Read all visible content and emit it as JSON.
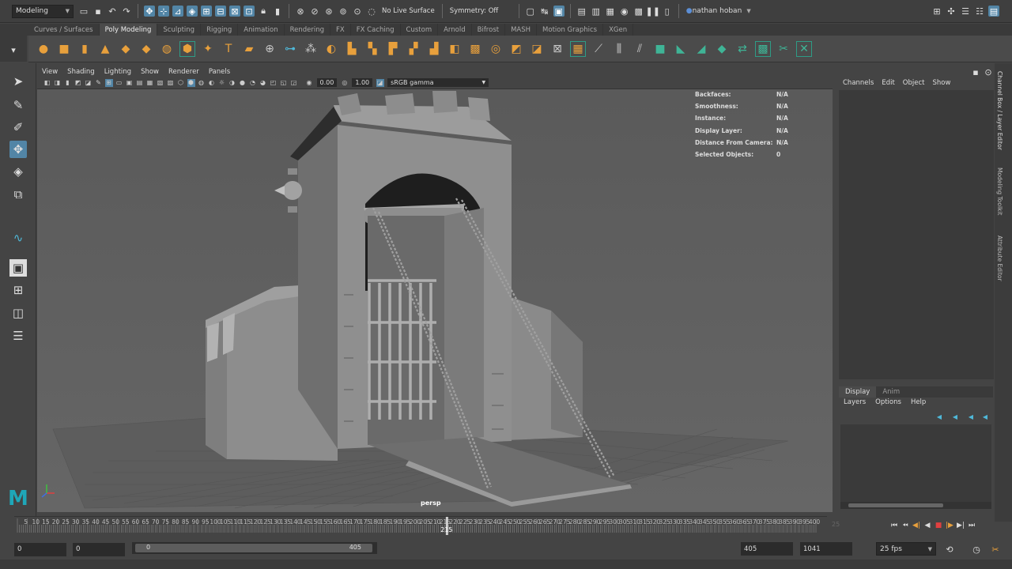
{
  "statusline": {
    "workspace": "Modeling",
    "live_surface": "No Live Surface",
    "symmetry": "Symmetry: Off",
    "user": "nathan hoban"
  },
  "shelf": {
    "tabs": [
      "Curves / Surfaces",
      "Poly Modeling",
      "Sculpting",
      "Rigging",
      "Animation",
      "Rendering",
      "FX",
      "FX Caching",
      "Custom",
      "Arnold",
      "Bifrost",
      "MASH",
      "Motion Graphics",
      "XGen"
    ],
    "active_tab": "Poly Modeling"
  },
  "viewport": {
    "menus": [
      "View",
      "Shading",
      "Lighting",
      "Show",
      "Renderer",
      "Panels"
    ],
    "exposure": "0.00",
    "gamma": "1.00",
    "color_space": "sRGB gamma",
    "camera": "persp",
    "hud": [
      {
        "label": "Backfaces:",
        "value": "N/A"
      },
      {
        "label": "Smoothness:",
        "value": "N/A"
      },
      {
        "label": "Instance:",
        "value": "N/A"
      },
      {
        "label": "Display Layer:",
        "value": "N/A"
      },
      {
        "label": "Distance From Camera:",
        "value": "N/A"
      },
      {
        "label": "Selected Objects:",
        "value": "0"
      }
    ]
  },
  "channel_box": {
    "menus": [
      "Channels",
      "Edit",
      "Object",
      "Show"
    ],
    "side_tabs": [
      "Channel Box / Layer Editor",
      "Modeling Toolkit",
      "Attribute Editor"
    ]
  },
  "layer_editor": {
    "tabs": [
      "Display",
      "Anim"
    ],
    "active_tab": "Display",
    "menus": [
      "Layers",
      "Options",
      "Help"
    ]
  },
  "time_slider": {
    "ticks": [
      "5",
      "10",
      "15",
      "20",
      "25",
      "30",
      "35",
      "40",
      "45",
      "50",
      "55",
      "60",
      "65",
      "70",
      "75",
      "80",
      "85",
      "90",
      "95",
      "100",
      "105",
      "110",
      "115",
      "120",
      "125",
      "130",
      "135",
      "140",
      "145",
      "150",
      "155",
      "160",
      "165",
      "170",
      "175",
      "180",
      "185",
      "190",
      "195",
      "200",
      "205",
      "210",
      "215",
      "220",
      "225",
      "230",
      "235",
      "240",
      "245",
      "250",
      "255",
      "260",
      "265",
      "270",
      "275",
      "280",
      "285",
      "290",
      "295",
      "300",
      "305",
      "310",
      "315",
      "320",
      "325",
      "330",
      "335",
      "340",
      "345",
      "350",
      "355",
      "360",
      "365",
      "370",
      "375",
      "380",
      "385",
      "390",
      "395",
      "400"
    ],
    "current_frame": "215",
    "end_label": "25"
  },
  "range": {
    "start": "0",
    "anim_start": "0",
    "slider_start": "0",
    "slider_end": "405",
    "playback_end": "405",
    "anim_end": "1041",
    "fps": "25 fps"
  },
  "colors": {
    "accent": "#5285a6",
    "shelf_orange": "#e8a03c",
    "shelf_teal": "#3fb496",
    "maya_logo": "#1fa7b8"
  }
}
